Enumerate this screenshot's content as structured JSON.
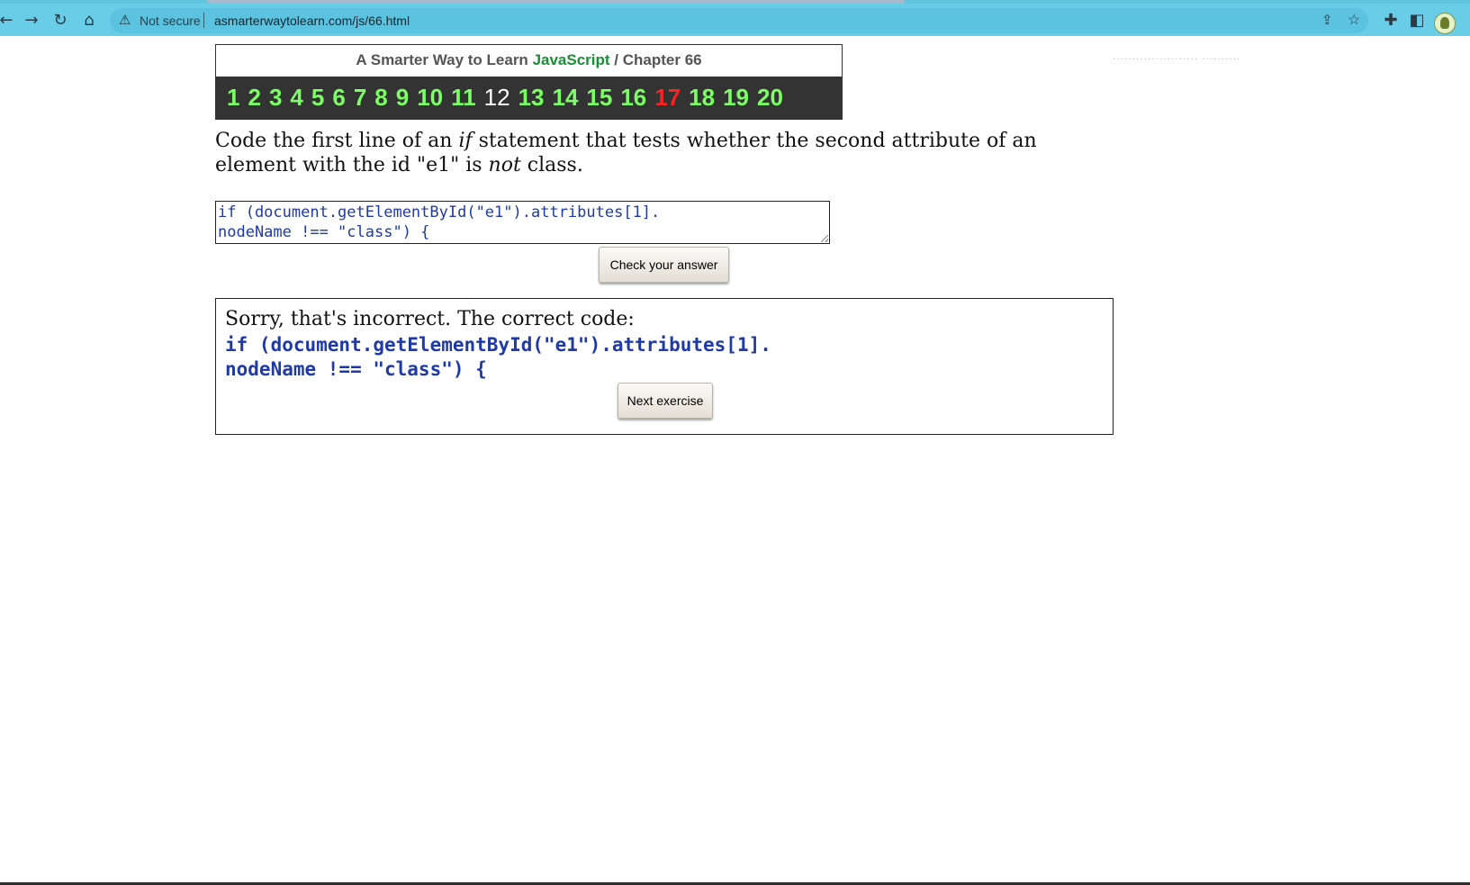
{
  "browser": {
    "security_label": "Not secure",
    "url": "asmarterwaytolearn.com/js/66.html",
    "icons": [
      "back-icon",
      "forward-icon",
      "reload-icon",
      "home-icon",
      "warning-icon",
      "share-icon",
      "star-icon",
      "extensions-icon",
      "side-panel-icon",
      "profile-avatar"
    ]
  },
  "header": {
    "title_prefix": "A Smarter Way to Learn",
    "title_brand": "JavaScript",
    "title_sep": "/",
    "chapter": "Chapter 66",
    "exercises": [
      "1",
      "2",
      "3",
      "4",
      "5",
      "6",
      "7",
      "8",
      "9",
      "10",
      "11",
      "12",
      "13",
      "14",
      "15",
      "16",
      "17",
      "18",
      "19",
      "20"
    ],
    "current_exercise": "12",
    "highlight_exercise": "17",
    "colors": {
      "number": "#7cff65",
      "current": "#ffffff",
      "highlight": "#ff2222",
      "brand": "#149132"
    }
  },
  "question": {
    "part1": "Code the first line of an ",
    "em1": "if",
    "part2": " statement that tests whether the second attribute of an element with the id \"e1\" is ",
    "em2": "not",
    "part3": " class."
  },
  "answer": {
    "value": "if (document.getElementById(\"e1\").attributes[1].\nnodeName !== \"class\") {"
  },
  "check_button": "Check your answer",
  "feedback": {
    "message": "Sorry, that's incorrect. The correct code:",
    "correct_code": "if (document.getElementById(\"e1\").attributes[1].\nnodeName !== \"class\") {",
    "next_button": "Next exercise"
  }
}
